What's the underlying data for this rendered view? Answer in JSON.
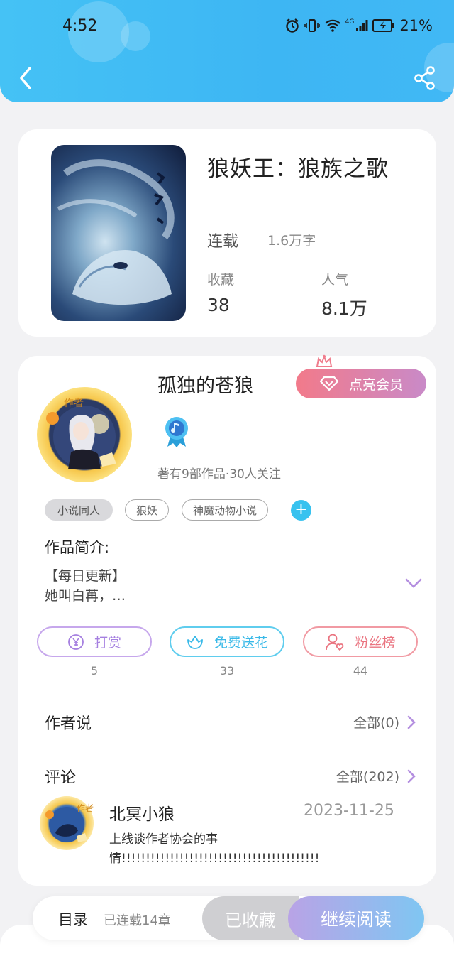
{
  "status_bar": {
    "time": "4:52",
    "network": "4G",
    "battery": "21%"
  },
  "colors": {
    "header": "#3db6f3",
    "accent": "#38c2ef",
    "vip_start": "#f27a8a",
    "vip_end": "#c98ac8",
    "reward": "#b48fe0",
    "flower": "#38c2ef",
    "fans": "#ee7c86"
  },
  "icons": {
    "back": "chevron-left-icon",
    "share": "share-icon",
    "reward": "yen-icon",
    "flower": "flower-icon",
    "fans": "user-heart-icon",
    "expand": "chevron-down-icon",
    "more": "chevron-right-icon",
    "vip": "diamond-icon",
    "crown": "crown-icon",
    "level": "music-note-badge-icon"
  },
  "book": {
    "title": "狼妖王：狼族之歌",
    "status": "连载",
    "words": "1.6万字",
    "favorites_label": "收藏",
    "favorites": "38",
    "popularity_label": "人气",
    "popularity": "8.1万"
  },
  "author": {
    "badge": "作者",
    "name": "孤独的苍狼",
    "vip_label": "点亮会员",
    "meta": "著有9部作品·30人关注"
  },
  "tags": [
    "小说同人",
    "狼妖",
    "神魔动物小说"
  ],
  "intro": {
    "label": "作品简介:",
    "line1": "【每日更新】",
    "line2": "她叫白苒，…"
  },
  "actions": [
    {
      "label": "打赏",
      "count": "5"
    },
    {
      "label": "免费送花",
      "count": "33"
    },
    {
      "label": "粉丝榜",
      "count": "44"
    }
  ],
  "author_says": {
    "title": "作者说",
    "link": "全部(0)"
  },
  "comments": {
    "title": "评论",
    "link": "全部(202)",
    "items": [
      {
        "badge": "作者",
        "name": "北冥小狼",
        "date": "2023-11-25",
        "text": "上线谈作者协会的事情!!!!!!!!!!!!!!!!!!!!!!!!!!!!!!!!!!!!!!!!!"
      }
    ]
  },
  "bottom_bar": {
    "toc": "目录",
    "serialized": "已连载14章",
    "favorited": "已收藏",
    "continue": "继续阅读"
  }
}
